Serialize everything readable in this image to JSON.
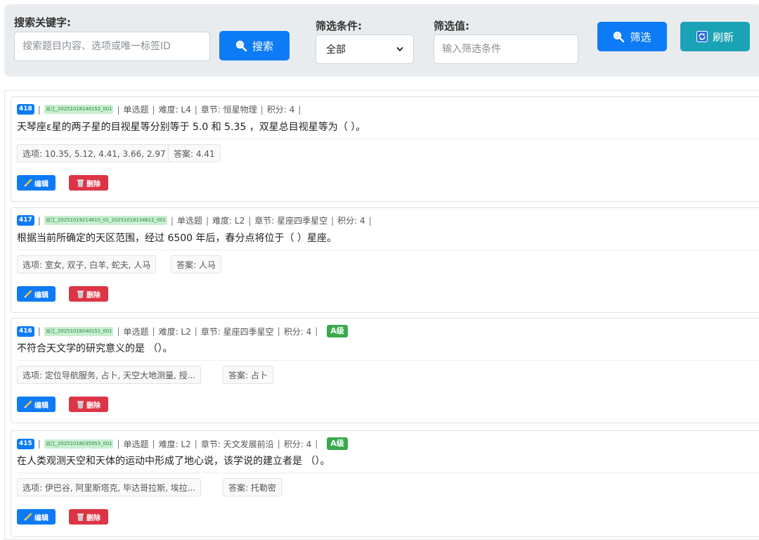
{
  "toolbar": {
    "search_label": "搜索关键字:",
    "search_placeholder": "搜索题目内容、选项或唯一标签ID",
    "search_button": "搜索",
    "filter_label": "筛选条件:",
    "filter_selected": "全部",
    "value_label": "筛选值:",
    "value_placeholder": "输入筛选条件",
    "filter_button": "筛选",
    "refresh_button": "刷新"
  },
  "actions": {
    "edit": "编辑",
    "delete": "删除"
  },
  "colors": {
    "primary": "#0d7bf5",
    "teal": "#1aa3b6",
    "danger": "#dc3545",
    "success": "#3aaa4e"
  },
  "questions": [
    {
      "id": "418",
      "tag": "派江_20251018140152_001",
      "type": "单选题",
      "difficulty": "难度: L4",
      "chapter": "章节: 恒星物理",
      "score": "积分: 4",
      "grade": "",
      "text": "天琴座ε星的两子星的目视星等分别等于 5.0 和 5.35 ，双星总目视星等为（ ）。",
      "options": "选项: 10.35, 5.12, 4.41, 3.66, 2.97",
      "answer": "答案: 4.41"
    },
    {
      "id": "417",
      "tag": "派江_20251019214610_01_20251018134612_001",
      "type": "单选题",
      "difficulty": "难度: L2",
      "chapter": "章节: 星座四季星空",
      "score": "积分: 4",
      "grade": "",
      "text": "根据当前所确定的天区范围，经过 6500 年后，春分点将位于（ ）星座。",
      "options": "选项: 室女, 双子, 白羊, 蛇夫, 人马",
      "answer": "答案: 人马"
    },
    {
      "id": "416",
      "tag": "派江_20251018040151_001",
      "type": "单选题",
      "difficulty": "难度: L2",
      "chapter": "章节: 星座四季星空",
      "score": "积分: 4",
      "grade": "A级",
      "text": "不符合天文学的研究意义的是 （）。",
      "options": "选项: 定位导航服务, 占卜, 天空大地测量, 授...",
      "answer": "答案: 占卜"
    },
    {
      "id": "415",
      "tag": "派江_20251018035953_001",
      "type": "单选题",
      "difficulty": "难度: L2",
      "chapter": "章节: 天文发展前沿",
      "score": "积分: 4",
      "grade": "A级",
      "text": "在人类观测天空和天体的运动中形成了地心说，该学说的建立者是 （）。",
      "options": "选项: 伊巴谷, 阿里斯塔克, 毕达哥拉斯, 埃拉...",
      "answer": "答案: 托勒密"
    }
  ]
}
